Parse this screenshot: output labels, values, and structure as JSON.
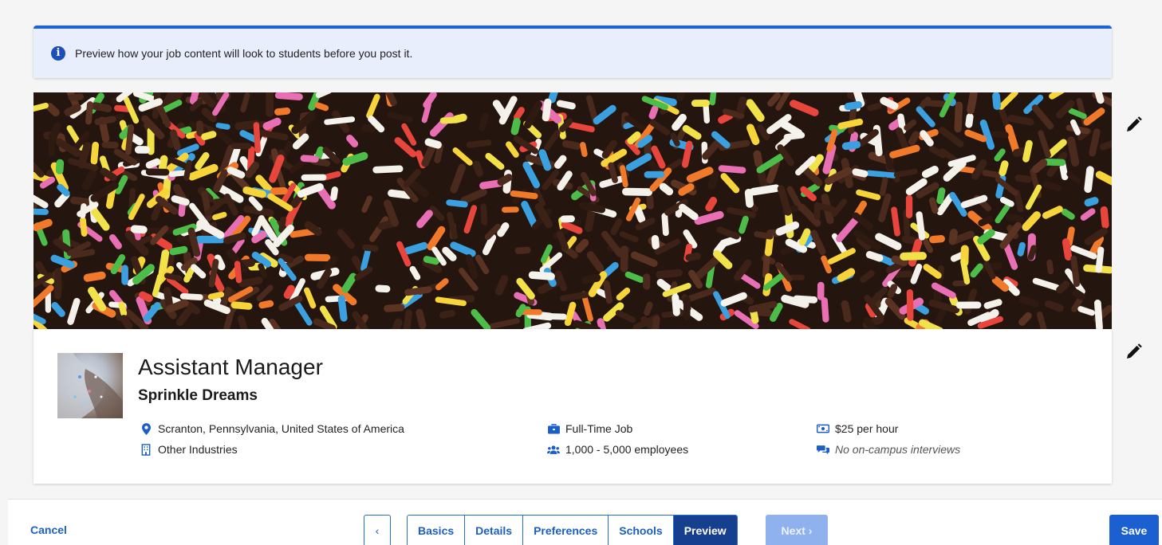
{
  "banner": {
    "text": "Preview how your job content will look to students before you post it."
  },
  "job": {
    "title": "Assistant Manager",
    "company": "Sprinkle Dreams",
    "location": "Scranton, Pennsylvania, United States of America",
    "industry": "Other Industries",
    "job_type": "Full-Time Job",
    "employees": "1,000 - 5,000 employees",
    "pay": "$25 per hour",
    "interviews": "No on-campus interviews"
  },
  "footer": {
    "cancel_label": "Cancel",
    "prev_glyph": "‹",
    "steps": [
      {
        "label": "Basics"
      },
      {
        "label": "Details"
      },
      {
        "label": "Preferences"
      },
      {
        "label": "Schools"
      },
      {
        "label": "Preview"
      }
    ],
    "next_label": "Next ›",
    "save_label": "Save"
  },
  "icons": {
    "info": "info-circle-icon",
    "edit": "pencil-icon",
    "location": "map-pin-icon",
    "industry": "building-icon",
    "job_type": "briefcase-icon",
    "employees": "users-icon",
    "pay": "money-bill-icon",
    "interviews": "comments-icon"
  },
  "colors": {
    "accent": "#1c64d4",
    "banner_bg": "#e8eefc",
    "step_active": "#173f8f",
    "next_disabled": "#8fb1ee",
    "save": "#1b5fd1",
    "icon_blue": "#1c5fc4"
  }
}
